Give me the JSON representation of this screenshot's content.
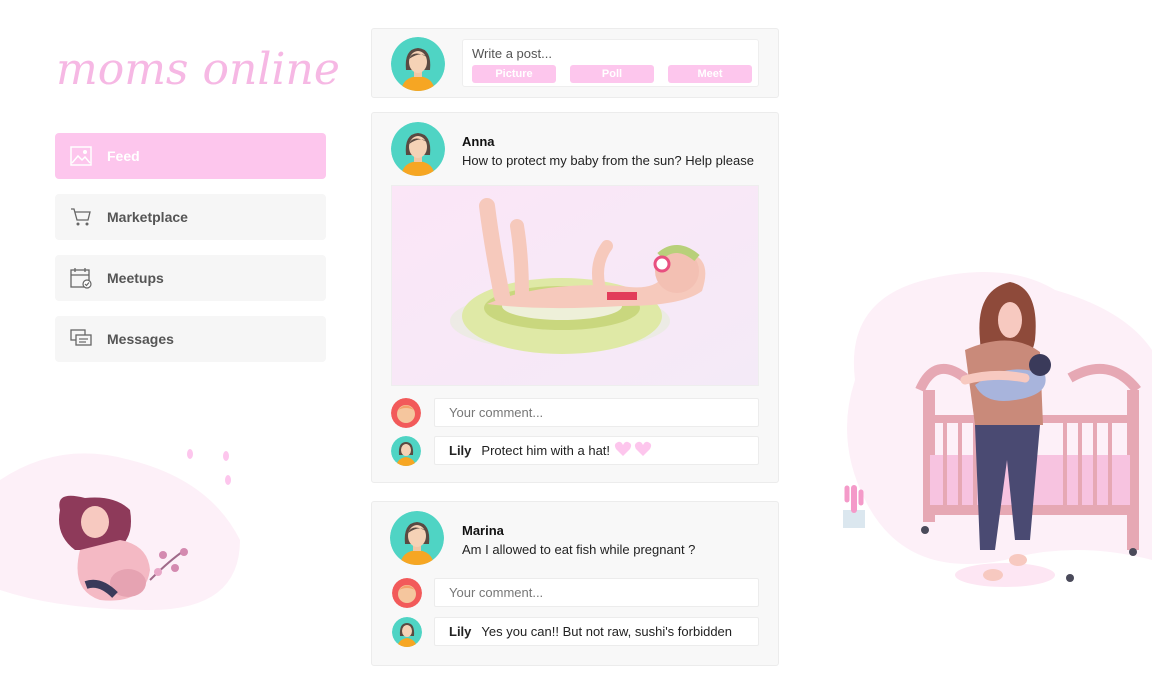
{
  "brand": {
    "logo_text": "moms online"
  },
  "nav": {
    "items": [
      {
        "label": "Feed",
        "icon": "image-icon"
      },
      {
        "label": "Marketplace",
        "icon": "cart-icon"
      },
      {
        "label": "Meetups",
        "icon": "calendar-icon"
      },
      {
        "label": "Messages",
        "icon": "chat-icon"
      }
    ]
  },
  "composer": {
    "placeholder": "Write a post...",
    "buttons": [
      "Picture",
      "Poll",
      "Meet"
    ]
  },
  "posts": [
    {
      "author": "Anna",
      "text": "How to protect my baby from the sun? Help please",
      "comment_placeholder": "Your comment...",
      "comments": [
        {
          "author": "Lily",
          "text": "Protect him with a hat!",
          "reaction": "hearts"
        }
      ]
    },
    {
      "author": "Marina",
      "text": "Am I allowed to eat fish while pregnant ?",
      "comment_placeholder": "Your comment...",
      "comments": [
        {
          "author": "Lily",
          "text": "Yes you can!! But not raw, sushi's forbidden"
        }
      ]
    }
  ],
  "colors": {
    "accent": "#fdc6ed",
    "avatar_bg": "#4fd4c4"
  }
}
